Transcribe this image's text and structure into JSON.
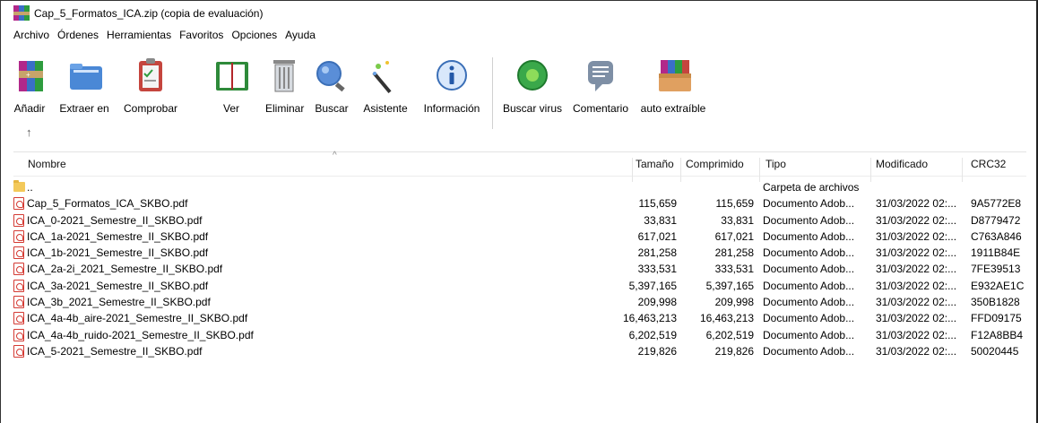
{
  "window": {
    "title": "Cap_5_Formatos_ICA.zip (copia de evaluación)"
  },
  "menu": [
    "Archivo",
    "Órdenes",
    "Herramientas",
    "Favoritos",
    "Opciones",
    "Ayuda"
  ],
  "toolbar": [
    {
      "label": "Añadir",
      "icon": "add-books-icon"
    },
    {
      "label": "Extraer en",
      "icon": "extract-folder-icon"
    },
    {
      "label": "Comprobar",
      "icon": "test-clipboard-icon"
    },
    {
      "label": "Ver",
      "icon": "view-book-icon"
    },
    {
      "label": "Eliminar",
      "icon": "trash-icon"
    },
    {
      "label": "Buscar",
      "icon": "search-magnifier-icon"
    },
    {
      "label": "Asistente",
      "icon": "wizard-wand-icon"
    },
    {
      "label": "Información",
      "icon": "info-icon"
    },
    {
      "label": "Buscar virus",
      "icon": "virus-scan-icon"
    },
    {
      "label": "Comentario",
      "icon": "comment-icon"
    },
    {
      "label": "auto extraíble",
      "icon": "sfx-box-icon"
    }
  ],
  "columns": {
    "name": "Nombre",
    "size": "Tamaño",
    "packed": "Comprimido",
    "type": "Tipo",
    "modified": "Modificado",
    "crc": "CRC32"
  },
  "parent_row": {
    "name": "..",
    "type": "Carpeta de archivos"
  },
  "files": [
    {
      "name": "Cap_5_Formatos_ICA_SKBO.pdf",
      "size": "115,659",
      "packed": "115,659",
      "type": "Documento Adob...",
      "modified": "31/03/2022 02:...",
      "crc": "9A5772E8"
    },
    {
      "name": "ICA_0-2021_Semestre_II_SKBO.pdf",
      "size": "33,831",
      "packed": "33,831",
      "type": "Documento Adob...",
      "modified": "31/03/2022 02:...",
      "crc": "D8779472"
    },
    {
      "name": "ICA_1a-2021_Semestre_II_SKBO.pdf",
      "size": "617,021",
      "packed": "617,021",
      "type": "Documento Adob...",
      "modified": "31/03/2022 02:...",
      "crc": "C763A846"
    },
    {
      "name": "ICA_1b-2021_Semestre_II_SKBO.pdf",
      "size": "281,258",
      "packed": "281,258",
      "type": "Documento Adob...",
      "modified": "31/03/2022 02:...",
      "crc": "1911B84E"
    },
    {
      "name": "ICA_2a-2i_2021_Semestre_II_SKBO.pdf",
      "size": "333,531",
      "packed": "333,531",
      "type": "Documento Adob...",
      "modified": "31/03/2022 02:...",
      "crc": "7FE39513"
    },
    {
      "name": "ICA_3a-2021_Semestre_II_SKBO.pdf",
      "size": "5,397,165",
      "packed": "5,397,165",
      "type": "Documento Adob...",
      "modified": "31/03/2022 02:...",
      "crc": "E932AE1C"
    },
    {
      "name": "ICA_3b_2021_Semestre_II_SKBO.pdf",
      "size": "209,998",
      "packed": "209,998",
      "type": "Documento Adob...",
      "modified": "31/03/2022 02:...",
      "crc": "350B1828"
    },
    {
      "name": "ICA_4a-4b_aire-2021_Semestre_II_SKBO.pdf",
      "size": "16,463,213",
      "packed": "16,463,213",
      "type": "Documento Adob...",
      "modified": "31/03/2022 02:...",
      "crc": "FFD09175"
    },
    {
      "name": "ICA_4a-4b_ruido-2021_Semestre_II_SKBO.pdf",
      "size": "6,202,519",
      "packed": "6,202,519",
      "type": "Documento Adob...",
      "modified": "31/03/2022 02:...",
      "crc": "F12A8BB4"
    },
    {
      "name": "ICA_5-2021_Semestre_II_SKBO.pdf",
      "size": "219,826",
      "packed": "219,826",
      "type": "Documento Adob...",
      "modified": "31/03/2022 02:...",
      "crc": "50020445"
    }
  ],
  "colors": {
    "pdf_red": "#d43a33",
    "folder_yellow": "#f3c95a"
  }
}
